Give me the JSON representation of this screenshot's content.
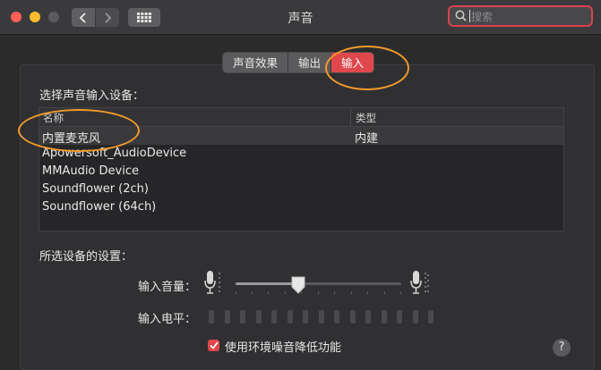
{
  "window": {
    "title": "声音"
  },
  "search": {
    "placeholder": "搜索"
  },
  "tabs": [
    {
      "label": "声音效果"
    },
    {
      "label": "输出"
    },
    {
      "label": "输入"
    }
  ],
  "input": {
    "section_label": "选择声音输入设备：",
    "columns": {
      "name": "名称",
      "type": "类型"
    },
    "devices": [
      {
        "name": "内置麦克风",
        "type": "内建"
      },
      {
        "name": "Apowersoft_AudioDevice",
        "type": ""
      },
      {
        "name": "MMAudio Device",
        "type": ""
      },
      {
        "name": "Soundflower (2ch)",
        "type": ""
      },
      {
        "name": "Soundflower (64ch)",
        "type": ""
      }
    ]
  },
  "settings": {
    "section_label": "所选设备的设置：",
    "volume_label": "输入音量：",
    "volume_level": 0.38,
    "level_label": "输入电平：",
    "level_count": 15,
    "noise_reduction_label": "使用环境噪音降低功能",
    "noise_reduction_checked": true
  },
  "help": {
    "label": "?"
  },
  "colors": {
    "accent": "#e0474c",
    "annotation": "#f39a2c"
  }
}
